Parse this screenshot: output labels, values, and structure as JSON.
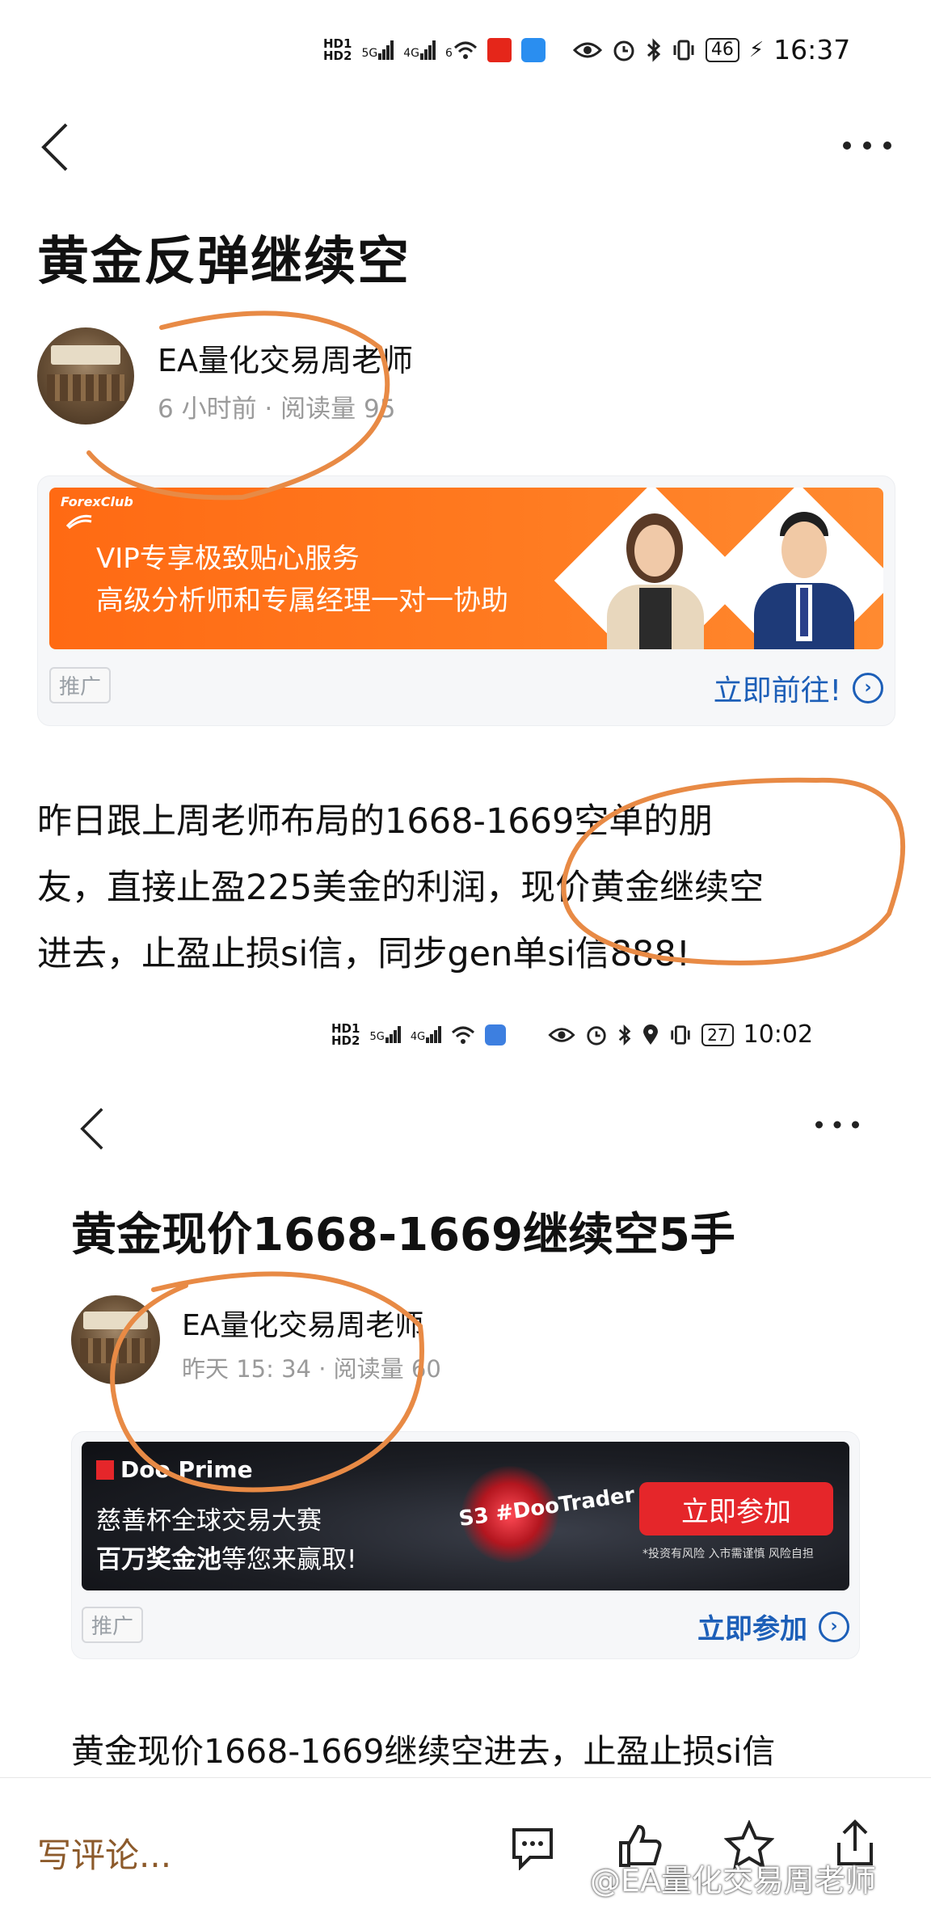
{
  "status1": {
    "sig1": "5G",
    "sig2": "4G",
    "sig3": "6",
    "battery": "46",
    "time": "16:37"
  },
  "post1": {
    "title": "黄金反弹继续空",
    "author": "EA量化交易周老师",
    "meta": "6 小时前 · 阅读量 95",
    "ad": {
      "brand": "ForexClub",
      "line1": "VIP专享极致贴心服务",
      "line2": "高级分析师和专属经理一对一协助",
      "tag": "推广",
      "link": "立即前往!"
    },
    "body": [
      "昨日跟上周老师布局的1668-1669空单的朋",
      "友，直接止盈225美金的利润，现价黄金继续空",
      "进去，止盈止损si信，同步gen单si信888!"
    ]
  },
  "status2": {
    "sig1": "5G",
    "sig2": "4G",
    "battery": "27",
    "time": "10:02"
  },
  "post2": {
    "title": "黄金现价1668-1669继续空5手",
    "author": "EA量化交易周老师",
    "meta": "昨天 15: 34 · 阅读量 60",
    "ad": {
      "brand": "Doo Prime",
      "line1": "慈善杯全球交易大赛",
      "line2_bold": "百万奖金池",
      "line2_rest": "等您来赢取!",
      "season": "S3 #DooTrader",
      "cta": "立即参加",
      "disclaimer": "*投资有风险 入市需谨慎 风险自担",
      "tag": "推广",
      "link": "立即参加"
    },
    "body": "黄金现价1668-1669继续空进去，止盈止损si信"
  },
  "bottom": {
    "comment_placeholder": "写评论...",
    "watermark": "@EA量化交易周老师"
  },
  "colors": {
    "ad_orange": "#ff6a13",
    "link_blue": "#1d5fb8",
    "annotation_orange": "#e88a45",
    "comment_brown": "#8c5a2b"
  }
}
